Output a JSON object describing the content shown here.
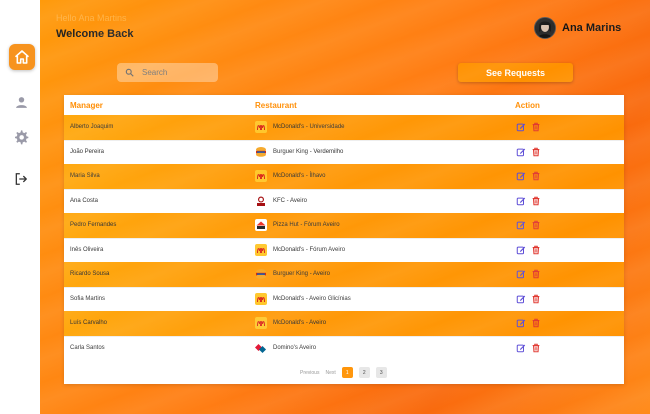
{
  "sidebar": {
    "items": [
      {
        "name": "home",
        "active": true
      },
      {
        "name": "profile"
      },
      {
        "name": "settings"
      },
      {
        "name": "logout"
      }
    ]
  },
  "header": {
    "hello": "Hello Ana Martins",
    "welcome": "Welcome Back",
    "profile_name": "Ana Marins"
  },
  "search": {
    "placeholder": "Search"
  },
  "toolbar": {
    "see_requests_label": "See Requests"
  },
  "table": {
    "headers": {
      "manager": "Manager",
      "restaurant": "Restaurant",
      "action": "Action"
    },
    "rows": [
      {
        "manager": "Alberto Joaquim",
        "restaurant": "McDonald's - Universidade",
        "logo": "mcdonalds"
      },
      {
        "manager": "João Pereira",
        "restaurant": "Burguer King -    Verdemilho",
        "logo": "burgerking"
      },
      {
        "manager": "Maria Silva",
        "restaurant": "McDonald's - Ílhavo",
        "logo": "mcdonalds"
      },
      {
        "manager": "Ana Costa",
        "restaurant": "KFC - Aveiro",
        "logo": "kfc"
      },
      {
        "manager": "Pedro Fernandes",
        "restaurant": "Pizza Hut - Fórum Aveiro",
        "logo": "pizzahut"
      },
      {
        "manager": "Inês Oliveira",
        "restaurant": "McDonald's - Fórum Aveiro",
        "logo": "mcdonalds"
      },
      {
        "manager": "Ricardo Sousa",
        "restaurant": "Burguer King -  Aveiro",
        "logo": "burgerking"
      },
      {
        "manager": "Sofia Martins",
        "restaurant": "McDonald's - Aveiro Glicínias",
        "logo": "mcdonalds"
      },
      {
        "manager": "Luís Carvalho",
        "restaurant": "McDonald's - Aveiro",
        "logo": "mcdonalds"
      },
      {
        "manager": "Carla Santos",
        "restaurant": "Domino's Aveiro",
        "logo": "dominos"
      }
    ]
  },
  "pagination": {
    "previous": "Previous",
    "next": "Next",
    "pages": [
      "1",
      "2",
      "3"
    ],
    "current": "1"
  },
  "colors": {
    "accent": "#ff9100",
    "edit": "#5b4bd6",
    "delete": "#e0342c"
  }
}
